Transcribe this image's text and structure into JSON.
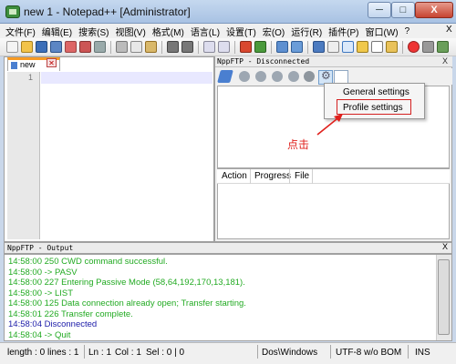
{
  "window": {
    "title": "new  1 - Notepad++ [Administrator]",
    "min": "─",
    "max": "□",
    "close": "X"
  },
  "menu": {
    "items": [
      "文件(F)",
      "编辑(E)",
      "搜索(S)",
      "视图(V)",
      "格式(M)",
      "语言(L)",
      "设置(T)",
      "宏(O)",
      "运行(R)",
      "插件(P)",
      "窗口(W)",
      "?"
    ],
    "close_x": "X"
  },
  "editor": {
    "tab_label": "new",
    "tab_close": "✕",
    "line_number": "1"
  },
  "ftp": {
    "title": "NppFTP - Disconnected",
    "close_x": "X",
    "menu": {
      "general": "General settings",
      "profile": "Profile settings"
    },
    "queue_columns": [
      "Action",
      "Progress",
      "File"
    ]
  },
  "annotation": {
    "text": "点击",
    "color": "#e0201c"
  },
  "output": {
    "title": "NppFTP - Output",
    "close_x": "X",
    "lines": [
      {
        "time": "14:58:00",
        "text": "250 CWD command successful.",
        "color": "#22aa22"
      },
      {
        "time": "14:58:00",
        "text": "-> PASV",
        "color": "#22aa22"
      },
      {
        "time": "14:58:00",
        "text": "227 Entering Passive Mode (58,64,192,170,13,181).",
        "color": "#22aa22"
      },
      {
        "time": "14:58:00",
        "text": "-> LIST",
        "color": "#22aa22"
      },
      {
        "time": "14:58:00",
        "text": "125 Data connection already open; Transfer starting.",
        "color": "#22aa22"
      },
      {
        "time": "14:58:01",
        "text": "226 Transfer complete.",
        "color": "#22aa22"
      },
      {
        "time": "14:58:04",
        "text": "Disconnected",
        "color": "#1a1aa8"
      },
      {
        "time": "14:58:04",
        "text": "-> Quit",
        "color": "#22aa22"
      }
    ]
  },
  "status": {
    "length": "length : 0",
    "lines": "lines : 1",
    "ln": "Ln : 1",
    "col": "Col : 1",
    "sel": "Sel : 0 | 0",
    "eol": "Dos\\Windows",
    "encoding": "UTF-8 w/o BOM",
    "mode": "INS"
  },
  "colors": {
    "tab_accent": "#f79a24",
    "highlight_box": "#d42020",
    "current_line": "#e8e8ff"
  }
}
